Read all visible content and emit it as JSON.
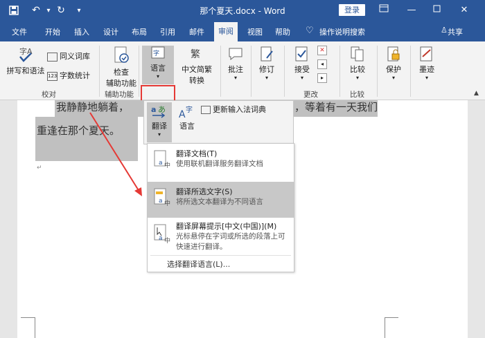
{
  "titlebar": {
    "doc_title": "那个夏天.docx - Word",
    "login": "登录"
  },
  "tabs": [
    "文件",
    "开始",
    "插入",
    "设计",
    "布局",
    "引用",
    "邮件",
    "审阅",
    "视图",
    "帮助"
  ],
  "active_tab": "审阅",
  "tell_me": "操作说明搜索",
  "share": "共享",
  "ribbon": {
    "spelling": "拼写和语法",
    "thesaurus": "同义词库",
    "wordcount": "字数统计",
    "proofing_group": "校对",
    "accessibility_btn_line1": "检查",
    "accessibility_btn_line2": "辅助功能",
    "accessibility_group": "辅助功能",
    "language_btn": "语言",
    "chinese_conv_line1": "中文简繁",
    "chinese_conv_line2": "转换",
    "comments": "批注",
    "track": "修订",
    "accept": "接受",
    "changes_group": "更改",
    "compare": "比较",
    "compare_group": "比较",
    "protect": "保护",
    "ink": "墨迹"
  },
  "language_panel": {
    "translate": "翻译",
    "language": "语言",
    "update_ime": "更新输入法词典"
  },
  "translate_menu": {
    "items": [
      {
        "title": "翻译文档(T)",
        "desc": "使用联机翻译服务翻译文档"
      },
      {
        "title": "翻译所选文字(S)",
        "desc": "将所选文本翻译为不同语言"
      },
      {
        "title": "翻译屏幕提示[中文(中国)](M)",
        "desc": "光标悬停在字词或所选的段落上可快速进行翻译。"
      }
    ],
    "footer": "选择翻译语言(L)..."
  },
  "document": {
    "line1a": "我静静地躺着，",
    "line1b": "，等着有一天我们",
    "line2": "重逢在那个夏天。"
  },
  "colors": {
    "word_blue": "#2b579a",
    "ribbon_bg": "#f3f3f3",
    "selection_gray": "#c0c0c0",
    "annotation_red": "#e53935"
  }
}
